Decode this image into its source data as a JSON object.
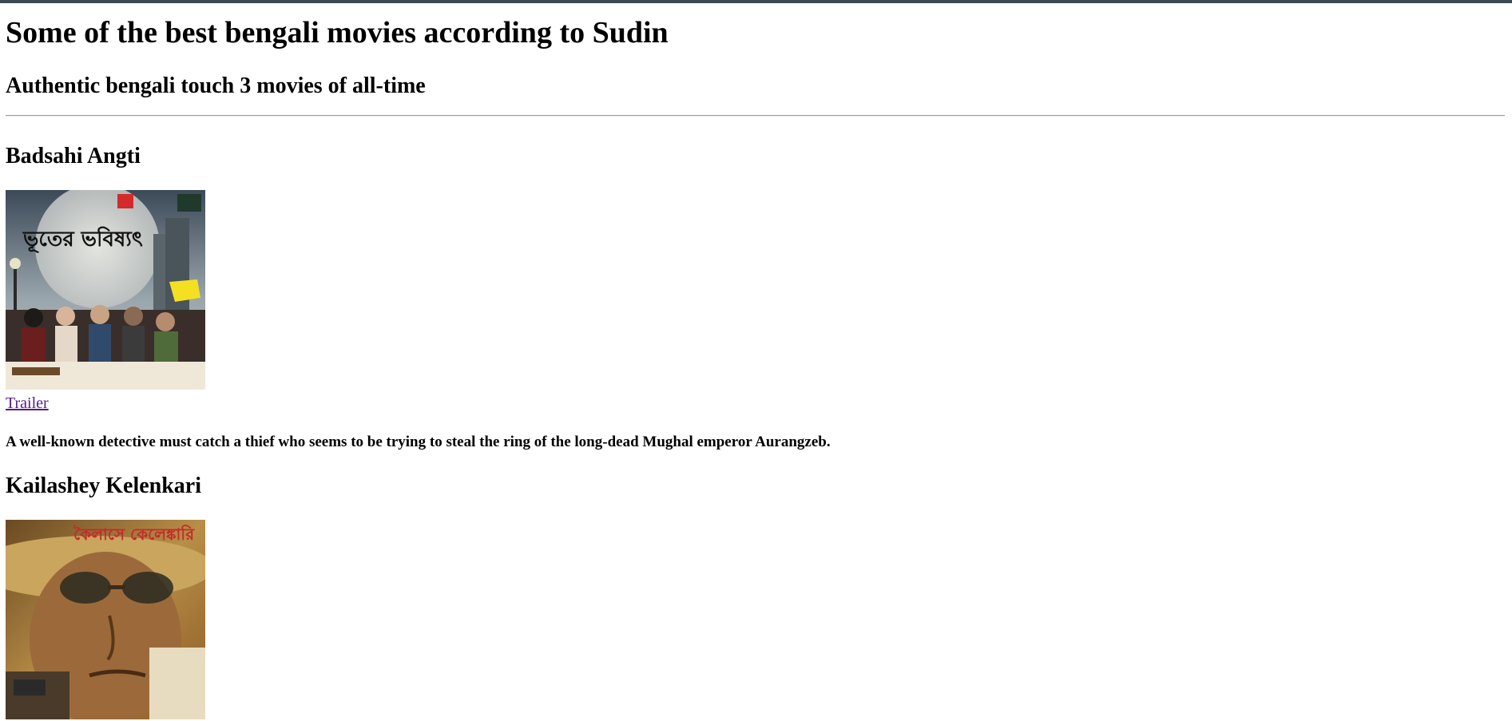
{
  "page": {
    "title": "Some of the best bengali movies according to Sudin",
    "subtitle": "Authentic bengali touch 3 movies of all-time"
  },
  "movies": [
    {
      "title": "Badsahi Angti",
      "poster_text": "ভূতের ভবিষ্যৎ",
      "trailer_label": "Trailer",
      "description": "A well-known detective must catch a thief who seems to be trying to steal the ring of the long-dead Mughal emperor Aurangzeb."
    },
    {
      "title": "Kailashey Kelenkari",
      "poster_text": "কৈলাসে কেলেঙ্কারি"
    }
  ]
}
